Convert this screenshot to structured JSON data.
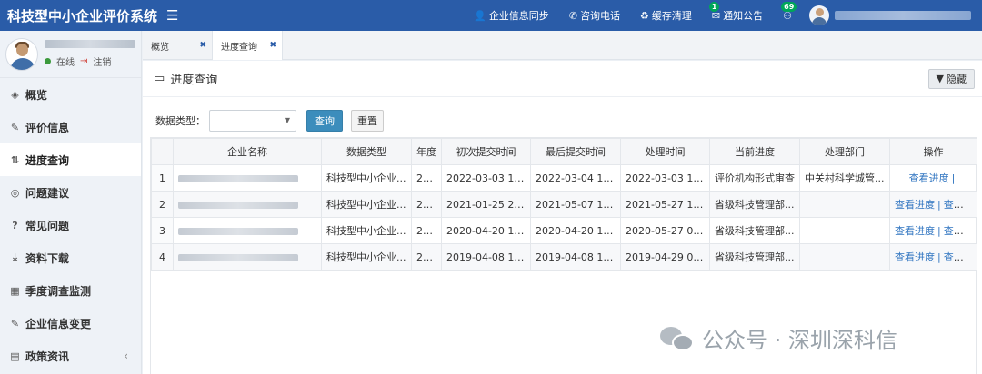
{
  "app": {
    "title": "科技型中小企业评价系统"
  },
  "topnav": {
    "items": [
      {
        "icon": "user-icon",
        "label": "企业信息同步"
      },
      {
        "icon": "phone-icon",
        "label": "咨询电话"
      },
      {
        "icon": "recycle-icon",
        "label": "缓存清理"
      },
      {
        "icon": "mail-icon",
        "label": "通知公告",
        "badge": "1"
      },
      {
        "icon": "users-icon",
        "label": "",
        "badge": "69"
      }
    ]
  },
  "sidebar": {
    "status_online": "在线",
    "logout": "注销",
    "items": [
      {
        "icon": "gauge-icon",
        "label": "概览",
        "active": false
      },
      {
        "icon": "edit-icon",
        "label": "评价信息",
        "active": false
      },
      {
        "icon": "sort-icon",
        "label": "进度查询",
        "active": true
      },
      {
        "icon": "comment-icon",
        "label": "问题建议",
        "active": false
      },
      {
        "icon": "question-icon",
        "label": "常见问题",
        "active": false
      },
      {
        "icon": "download-icon",
        "label": "资料下载",
        "active": false
      },
      {
        "icon": "table-icon",
        "label": "季度调查监测",
        "active": false
      },
      {
        "icon": "edit-icon",
        "label": "企业信息变更",
        "active": false
      },
      {
        "icon": "news-icon",
        "label": "政策资讯",
        "active": false,
        "caret": "‹"
      }
    ]
  },
  "tabs": [
    {
      "label": "概览",
      "active": false,
      "close": "✖"
    },
    {
      "label": "进度查询",
      "active": true,
      "close": "✖"
    }
  ],
  "page": {
    "title": "进度查询",
    "hide_button": "隐藏",
    "filter": {
      "label": "数据类型：",
      "select_value": "",
      "query_button": "查询",
      "reset_button": "重置"
    },
    "table": {
      "headers": [
        "",
        "企业名称",
        "数据类型",
        "年度",
        "初次提交时间",
        "最后提交时间",
        "处理时间",
        "当前进度",
        "处理部门",
        "操作"
      ],
      "rows": [
        {
          "idx": "1",
          "type": "科技型中小企业...",
          "year": "20...",
          "first": "2022-03-03 17:...",
          "last": "2022-03-04 13:...",
          "handled": "2022-03-03 17:...",
          "progress": "评价机构形式审查",
          "dept": "中关村科学城管...",
          "op1": "查看进度",
          "op2": ""
        },
        {
          "idx": "2",
          "type": "科技型中小企业...",
          "year": "20...",
          "first": "2021-01-25 21:...",
          "last": "2021-05-07 17:...",
          "handled": "2021-05-27 16:...",
          "progress": "省级科技管理部...",
          "dept": "",
          "op1": "查看进度",
          "op2": "查看..."
        },
        {
          "idx": "3",
          "type": "科技型中小企业...",
          "year": "20...",
          "first": "2020-04-20 15:...",
          "last": "2020-04-20 15:...",
          "handled": "2020-05-27 09:...",
          "progress": "省级科技管理部...",
          "dept": "",
          "op1": "查看进度",
          "op2": "查看..."
        },
        {
          "idx": "4",
          "type": "科技型中小企业...",
          "year": "20...",
          "first": "2019-04-08 11:...",
          "last": "2019-04-08 11:...",
          "handled": "2019-04-29 09:...",
          "progress": "省级科技管理部...",
          "dept": "",
          "op1": "查看进度",
          "op2": "查看..."
        }
      ]
    }
  },
  "watermark": {
    "text": "公众号 · 深圳深科信"
  }
}
